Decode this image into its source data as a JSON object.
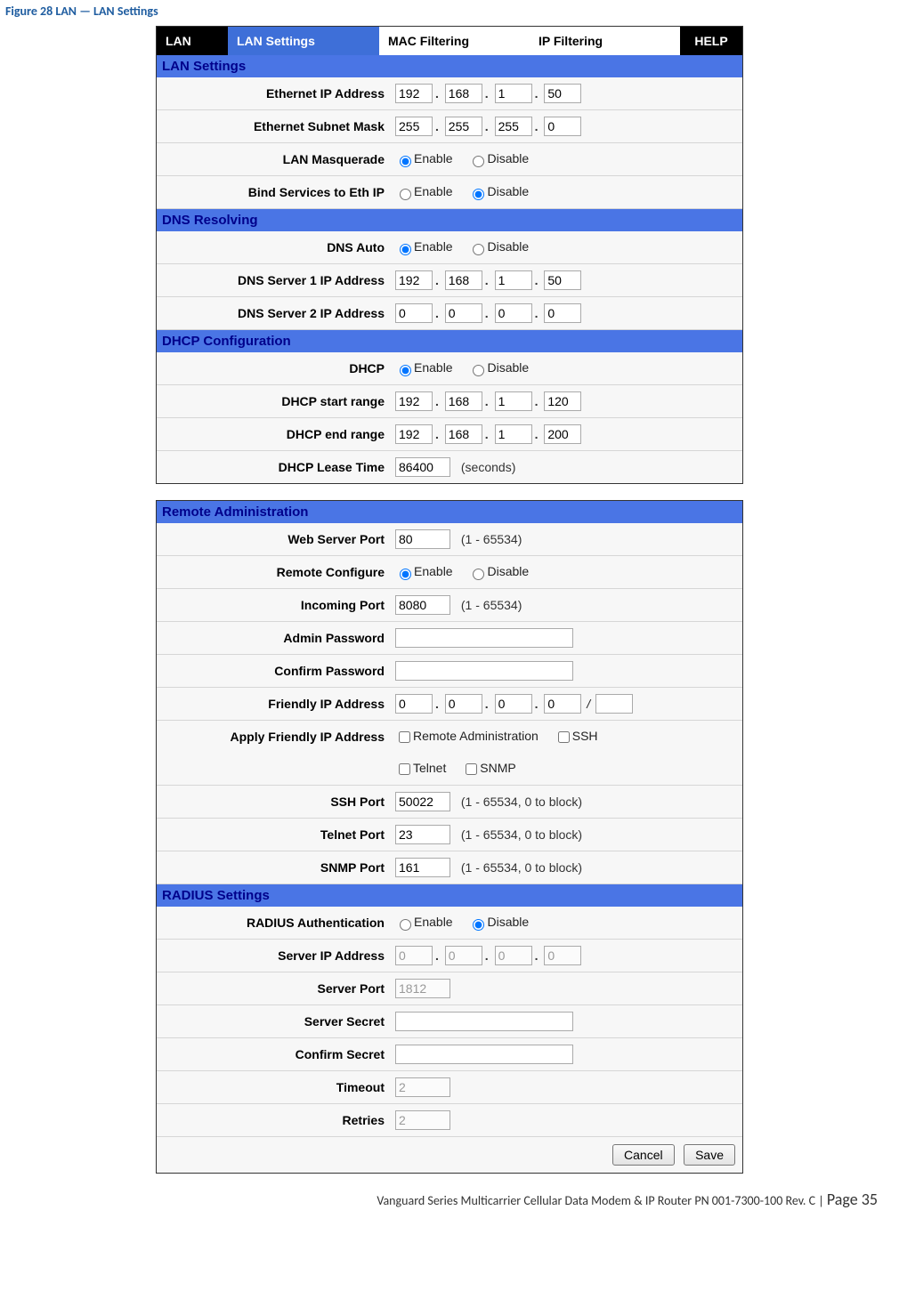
{
  "figure_title": "Figure 28 LAN — LAN Settings",
  "tabs": {
    "lan": "LAN",
    "lan_settings": "LAN Settings",
    "mac_filtering": "MAC Filtering",
    "ip_filtering": "IP Filtering",
    "help": "HELP"
  },
  "sections": {
    "lan_settings": "LAN Settings",
    "dns_resolving": "DNS Resolving",
    "dhcp_config": "DHCP Configuration",
    "remote_admin": "Remote Administration",
    "radius": "RADIUS Settings"
  },
  "labels": {
    "eth_ip": "Ethernet IP Address",
    "eth_mask": "Ethernet Subnet Mask",
    "lan_masq": "LAN Masquerade",
    "bind_svc": "Bind Services to Eth IP",
    "dns_auto": "DNS Auto",
    "dns1": "DNS Server 1 IP Address",
    "dns2": "DNS Server 2 IP Address",
    "dhcp": "DHCP",
    "dhcp_start": "DHCP start range",
    "dhcp_end": "DHCP end range",
    "dhcp_lease": "DHCP Lease Time",
    "web_port": "Web Server Port",
    "remote_cfg": "Remote Configure",
    "incoming_port": "Incoming Port",
    "admin_pw": "Admin Password",
    "confirm_pw": "Confirm Password",
    "friendly_ip": "Friendly IP Address",
    "apply_friendly": "Apply Friendly IP Address",
    "ssh_port": "SSH Port",
    "telnet_port": "Telnet Port",
    "snmp_port": "SNMP Port",
    "radius_auth": "RADIUS Authentication",
    "srv_ip": "Server IP Address",
    "srv_port": "Server Port",
    "srv_secret": "Server Secret",
    "confirm_secret": "Confirm Secret",
    "timeout": "Timeout",
    "retries": "Retries"
  },
  "options": {
    "enable": "Enable",
    "disable": "Disable",
    "remote_admin": "Remote Administration",
    "ssh": "SSH",
    "telnet": "Telnet",
    "snmp": "SNMP"
  },
  "hints": {
    "seconds": "(seconds)",
    "port_range": "(1 - 65534)",
    "port_range_block": "(1 - 65534, 0 to block)"
  },
  "values": {
    "eth_ip": [
      "192",
      "168",
      "1",
      "50"
    ],
    "eth_mask": [
      "255",
      "255",
      "255",
      "0"
    ],
    "lan_masq": "enable",
    "bind_svc": "disable",
    "dns_auto": "enable",
    "dns1": [
      "192",
      "168",
      "1",
      "50"
    ],
    "dns2": [
      "0",
      "0",
      "0",
      "0"
    ],
    "dhcp": "enable",
    "dhcp_start": [
      "192",
      "168",
      "1",
      "120"
    ],
    "dhcp_end": [
      "192",
      "168",
      "1",
      "200"
    ],
    "dhcp_lease": "86400",
    "web_port": "80",
    "remote_cfg": "enable",
    "incoming_port": "8080",
    "admin_pw": "",
    "confirm_pw": "",
    "friendly_ip": [
      "0",
      "0",
      "0",
      "0"
    ],
    "friendly_mask": "",
    "apply_remote_admin": false,
    "apply_ssh": false,
    "apply_telnet": false,
    "apply_snmp": false,
    "ssh_port": "50022",
    "telnet_port": "23",
    "snmp_port": "161",
    "radius_auth": "disable",
    "srv_ip": [
      "0",
      "0",
      "0",
      "0"
    ],
    "srv_port": "1812",
    "srv_secret": "",
    "confirm_secret": "",
    "timeout": "2",
    "retries": "2"
  },
  "buttons": {
    "cancel": "Cancel",
    "save": "Save"
  },
  "footer": {
    "text": "Vanguard Series Multicarrier Cellular Data Modem & IP Router PN 001-7300-100 Rev. C",
    "sep": " | ",
    "page": "Page 35"
  }
}
